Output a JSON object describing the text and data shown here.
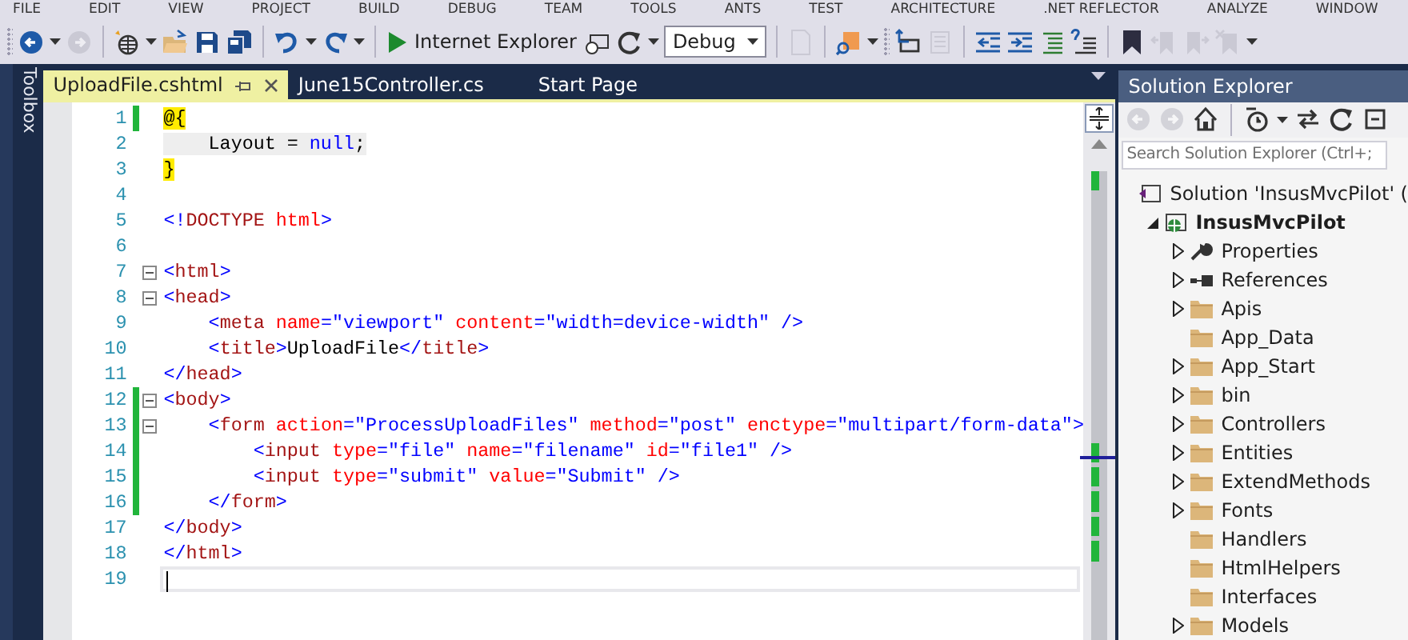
{
  "menu": [
    "FILE",
    "EDIT",
    "VIEW",
    "PROJECT",
    "BUILD",
    "DEBUG",
    "TEAM",
    "TOOLS",
    "ANTS",
    "TEST",
    "ARCHITECTURE",
    ".NET REFLECTOR",
    "ANALYZE",
    "WINDOW"
  ],
  "toolbar": [
    {
      "kind": "grip"
    },
    {
      "kind": "back",
      "disabled": false
    },
    {
      "kind": "caret"
    },
    {
      "kind": "forward",
      "disabled": true
    },
    {
      "kind": "sep"
    },
    {
      "kind": "new-project",
      "disabled": false
    },
    {
      "kind": "caret"
    },
    {
      "kind": "open",
      "disabled": false
    },
    {
      "kind": "save",
      "disabled": false
    },
    {
      "kind": "save-all",
      "disabled": false
    },
    {
      "kind": "sep"
    },
    {
      "kind": "undo",
      "disabled": false
    },
    {
      "kind": "caret"
    },
    {
      "kind": "redo",
      "disabled": false
    },
    {
      "kind": "caret"
    },
    {
      "kind": "sep"
    },
    {
      "kind": "run",
      "label": "Internet Explorer"
    },
    {
      "kind": "browser-link",
      "disabled": false
    },
    {
      "kind": "refresh",
      "disabled": false
    },
    {
      "kind": "caret"
    },
    {
      "kind": "select",
      "value": "Debug"
    },
    {
      "kind": "sep"
    },
    {
      "kind": "document",
      "disabled": true
    },
    {
      "kind": "sep"
    },
    {
      "kind": "find-folder",
      "disabled": false
    },
    {
      "kind": "caret"
    },
    {
      "kind": "grip"
    },
    {
      "kind": "window",
      "disabled": false
    },
    {
      "kind": "list",
      "disabled": true
    },
    {
      "kind": "sep"
    },
    {
      "kind": "outdent",
      "disabled": false
    },
    {
      "kind": "indent",
      "disabled": false
    },
    {
      "kind": "comment",
      "disabled": false
    },
    {
      "kind": "uncomment",
      "disabled": false
    },
    {
      "kind": "sep"
    },
    {
      "kind": "bookmark",
      "disabled": false
    },
    {
      "kind": "bookmark-prev",
      "disabled": true
    },
    {
      "kind": "bookmark-next",
      "disabled": true
    },
    {
      "kind": "bookmark-clear",
      "disabled": true
    },
    {
      "kind": "caret"
    }
  ],
  "toolbox": {
    "label": "Toolbox"
  },
  "tabs": [
    {
      "label": "UploadFile.cshtml",
      "selected": true
    },
    {
      "label": "June15Controller.cs",
      "selected": false
    },
    {
      "label": "Start Page",
      "selected": false
    }
  ],
  "editor": {
    "lines": [
      {
        "number": "1",
        "changed": true,
        "fold": false,
        "current": false,
        "tokens": [
          {
            "kind": "razor",
            "text": "@{"
          }
        ]
      },
      {
        "number": "2",
        "changed": false,
        "fold": false,
        "current": false,
        "tokens": [
          {
            "kind": "code",
            "text": "    Layout = "
          },
          {
            "kind": "code-keyword",
            "text": "null"
          },
          {
            "kind": "code",
            "text": ";"
          }
        ]
      },
      {
        "number": "3",
        "changed": false,
        "fold": false,
        "current": false,
        "tokens": [
          {
            "kind": "razor",
            "text": "}"
          }
        ]
      },
      {
        "number": "4",
        "changed": false,
        "fold": false,
        "current": false
      },
      {
        "number": "5",
        "changed": false,
        "fold": false,
        "current": false,
        "tokens": [
          {
            "kind": "delim",
            "text": "<!"
          },
          {
            "kind": "element",
            "text": "DOCTYPE "
          },
          {
            "kind": "attr",
            "text": "html"
          },
          {
            "kind": "delim",
            "text": ">"
          }
        ]
      },
      {
        "number": "6",
        "changed": false,
        "fold": false,
        "current": false
      },
      {
        "number": "7",
        "changed": false,
        "fold": true,
        "current": false,
        "tokens": [
          {
            "kind": "delim",
            "text": "<"
          },
          {
            "kind": "element",
            "text": "html"
          },
          {
            "kind": "delim",
            "text": ">"
          }
        ]
      },
      {
        "number": "8",
        "changed": false,
        "fold": true,
        "current": false,
        "tokens": [
          {
            "kind": "delim",
            "text": "<"
          },
          {
            "kind": "element",
            "text": "head"
          },
          {
            "kind": "delim",
            "text": ">"
          }
        ]
      },
      {
        "number": "9",
        "changed": false,
        "fold": false,
        "current": false,
        "tokens": [
          {
            "kind": "delim",
            "text": "    <"
          },
          {
            "kind": "element",
            "text": "meta "
          },
          {
            "kind": "attr",
            "text": "name"
          },
          {
            "kind": "delim",
            "text": "="
          },
          {
            "kind": "value",
            "text": "\"viewport\" "
          },
          {
            "kind": "attr",
            "text": "content"
          },
          {
            "kind": "delim",
            "text": "="
          },
          {
            "kind": "value",
            "text": "\"width=device-width\" "
          },
          {
            "kind": "delim",
            "text": "/>"
          }
        ]
      },
      {
        "number": "10",
        "changed": false,
        "fold": false,
        "current": false,
        "tokens": [
          {
            "kind": "delim",
            "text": "    <"
          },
          {
            "kind": "element",
            "text": "title"
          },
          {
            "kind": "delim",
            "text": ">"
          },
          {
            "kind": "text",
            "text": "UploadFile"
          },
          {
            "kind": "delim",
            "text": "</"
          },
          {
            "kind": "element",
            "text": "title"
          },
          {
            "kind": "delim",
            "text": ">"
          }
        ]
      },
      {
        "number": "11",
        "changed": false,
        "fold": false,
        "current": false,
        "tokens": [
          {
            "kind": "delim",
            "text": "</"
          },
          {
            "kind": "element",
            "text": "head"
          },
          {
            "kind": "delim",
            "text": ">"
          }
        ]
      },
      {
        "number": "12",
        "changed": true,
        "fold": true,
        "current": false,
        "tokens": [
          {
            "kind": "delim",
            "text": "<"
          },
          {
            "kind": "element",
            "text": "body"
          },
          {
            "kind": "delim",
            "text": ">"
          }
        ]
      },
      {
        "number": "13",
        "changed": true,
        "fold": true,
        "current": false,
        "tokens": [
          {
            "kind": "delim",
            "text": "    <"
          },
          {
            "kind": "element",
            "text": "form "
          },
          {
            "kind": "attr",
            "text": "action"
          },
          {
            "kind": "delim",
            "text": "="
          },
          {
            "kind": "value",
            "text": "\"ProcessUploadFiles\" "
          },
          {
            "kind": "attr",
            "text": "method"
          },
          {
            "kind": "delim",
            "text": "="
          },
          {
            "kind": "value",
            "text": "\"post\" "
          },
          {
            "kind": "attr",
            "text": "enctype"
          },
          {
            "kind": "delim",
            "text": "="
          },
          {
            "kind": "value",
            "text": "\"multipart/form-data\""
          },
          {
            "kind": "delim",
            "text": ">"
          }
        ]
      },
      {
        "number": "14",
        "changed": true,
        "fold": false,
        "current": false,
        "tokens": [
          {
            "kind": "delim",
            "text": "        <"
          },
          {
            "kind": "element",
            "text": "input "
          },
          {
            "kind": "attr",
            "text": "type"
          },
          {
            "kind": "delim",
            "text": "="
          },
          {
            "kind": "value",
            "text": "\"file\" "
          },
          {
            "kind": "attr",
            "text": "name"
          },
          {
            "kind": "delim",
            "text": "="
          },
          {
            "kind": "value",
            "text": "\"filename\" "
          },
          {
            "kind": "attr",
            "text": "id"
          },
          {
            "kind": "delim",
            "text": "="
          },
          {
            "kind": "value",
            "text": "\"file1\" "
          },
          {
            "kind": "delim",
            "text": "/>"
          }
        ]
      },
      {
        "number": "15",
        "changed": true,
        "fold": false,
        "current": false,
        "tokens": [
          {
            "kind": "delim",
            "text": "        <"
          },
          {
            "kind": "element",
            "text": "input "
          },
          {
            "kind": "attr",
            "text": "type"
          },
          {
            "kind": "delim",
            "text": "="
          },
          {
            "kind": "value",
            "text": "\"submit\" "
          },
          {
            "kind": "attr",
            "text": "value"
          },
          {
            "kind": "delim",
            "text": "="
          },
          {
            "kind": "value",
            "text": "\"Submit\" "
          },
          {
            "kind": "delim",
            "text": "/>"
          }
        ]
      },
      {
        "number": "16",
        "changed": true,
        "fold": false,
        "current": false,
        "tokens": [
          {
            "kind": "delim",
            "text": "    </"
          },
          {
            "kind": "element",
            "text": "form"
          },
          {
            "kind": "delim",
            "text": ">"
          }
        ]
      },
      {
        "number": "17",
        "changed": false,
        "fold": false,
        "current": false,
        "tokens": [
          {
            "kind": "delim",
            "text": "</"
          },
          {
            "kind": "element",
            "text": "body"
          },
          {
            "kind": "delim",
            "text": ">"
          }
        ]
      },
      {
        "number": "18",
        "changed": false,
        "fold": false,
        "current": false,
        "tokens": [
          {
            "kind": "delim",
            "text": "</"
          },
          {
            "kind": "element",
            "text": "html"
          },
          {
            "kind": "delim",
            "text": ">"
          }
        ]
      },
      {
        "number": "19",
        "changed": false,
        "fold": false,
        "current": true
      }
    ]
  },
  "solution_explorer": {
    "title": "Solution Explorer",
    "toolbar": [
      {
        "kind": "back",
        "disabled": true
      },
      {
        "kind": "forward",
        "disabled": true
      },
      {
        "kind": "home",
        "disabled": false
      },
      {
        "kind": "sep"
      },
      {
        "kind": "history",
        "disabled": false
      },
      {
        "kind": "caret"
      },
      {
        "kind": "sync",
        "disabled": false
      },
      {
        "kind": "refresh",
        "disabled": false
      },
      {
        "kind": "collapse",
        "disabled": false
      }
    ],
    "search": {
      "placeholder": "Search Solution Explorer (Ctrl+;"
    },
    "tree": [
      {
        "label": "Solution 'InsusMvcPilot' (",
        "kind": "solution",
        "children": [
          {
            "label": "InsusMvcPilot",
            "kind": "project",
            "expanded": true,
            "children": [
              {
                "label": "Properties",
                "kind": "properties",
                "expanded": false
              },
              {
                "label": "References",
                "kind": "references",
                "expanded": false
              },
              {
                "label": "Apis",
                "kind": "folder",
                "expanded": false
              },
              {
                "label": "App_Data",
                "kind": "folder"
              },
              {
                "label": "App_Start",
                "kind": "folder",
                "expanded": false
              },
              {
                "label": "bin",
                "kind": "folder",
                "expanded": false
              },
              {
                "label": "Controllers",
                "kind": "folder",
                "expanded": false
              },
              {
                "label": "Entities",
                "kind": "folder",
                "expanded": false
              },
              {
                "label": "ExtendMethods",
                "kind": "folder",
                "expanded": false
              },
              {
                "label": "Fonts",
                "kind": "folder",
                "expanded": false
              },
              {
                "label": "Handlers",
                "kind": "folder"
              },
              {
                "label": "HtmlHelpers",
                "kind": "folder"
              },
              {
                "label": "Interfaces",
                "kind": "folder"
              },
              {
                "label": "Models",
                "kind": "folder",
                "expanded": false
              }
            ]
          }
        ]
      }
    ]
  }
}
